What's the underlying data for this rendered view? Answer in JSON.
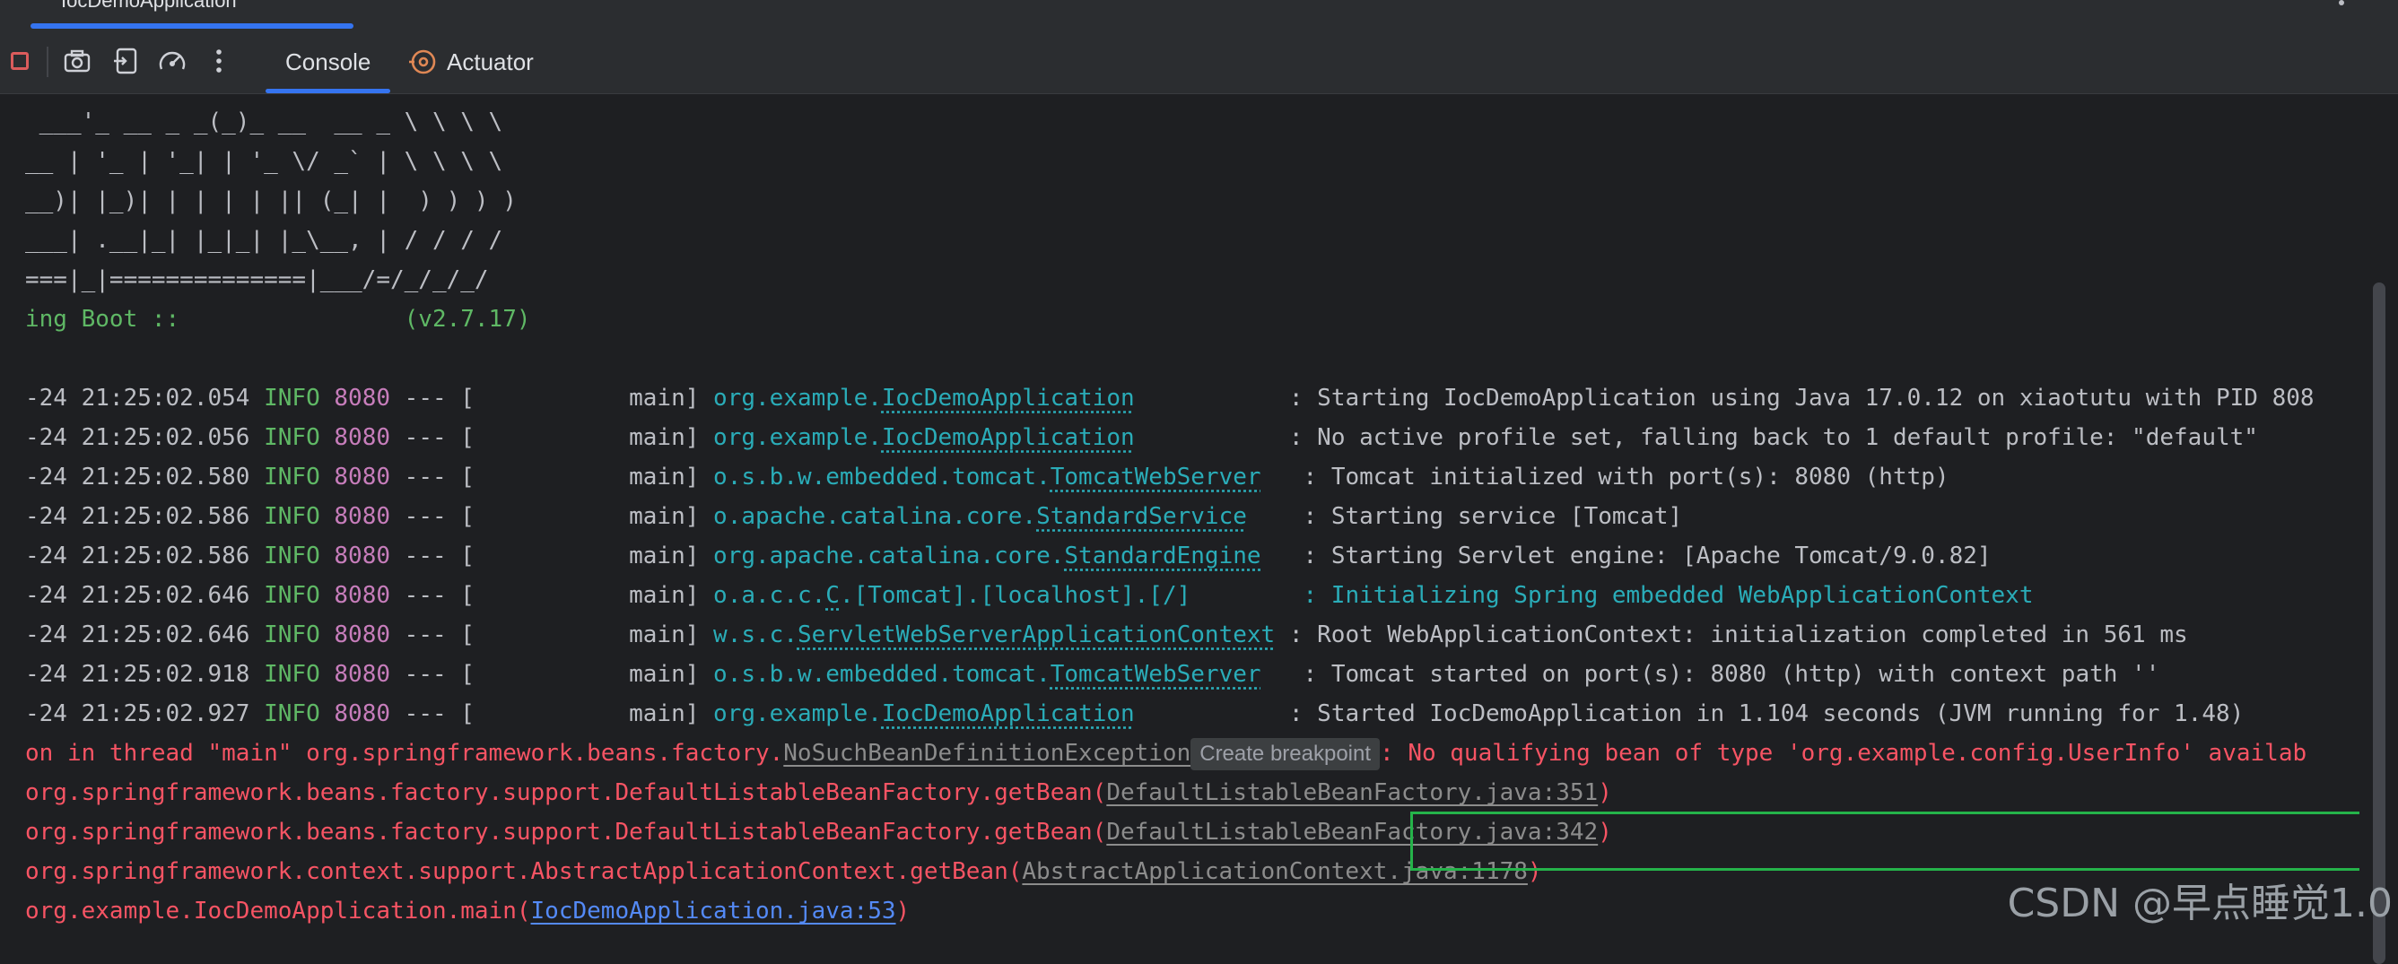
{
  "run_tab": {
    "label": "IocDemoApplication"
  },
  "toolbar": {
    "tabs": [
      {
        "label": "Console",
        "active": true
      },
      {
        "label": "Actuator",
        "active": false
      }
    ],
    "icons": [
      "stop-icon",
      "camera-icon",
      "restore-layout-icon",
      "speed-gauge-icon",
      "more-options-icon",
      "actuator-icon"
    ]
  },
  "banner": [
    " ___'_ __ _ _(_)_ __  __ _ \\ \\ \\ \\",
    "__ | '_ | '_| | '_ \\/ _` | \\ \\ \\ \\",
    "__)| |_)| | | | | || (_| |  ) ) ) )",
    "___| .__|_| |_|_| |_\\__, | / / / /",
    "===|_|==============|___/=/_/_/_/",
    "ing Boot ::                (v2.7.17)"
  ],
  "logs": [
    {
      "ts": "-24 21:25:02.054",
      "level": "INFO",
      "pid": "8080",
      "sep": " --- [           main] ",
      "pkg": "org.example.",
      "cls": "IocDemoApplication",
      "pad": "          ",
      "msg": " : Starting IocDemoApplication using Java 17.0.12 on xiaotutu with PID 808"
    },
    {
      "ts": "-24 21:25:02.056",
      "level": "INFO",
      "pid": "8080",
      "sep": " --- [           main] ",
      "pkg": "org.example.",
      "cls": "IocDemoApplication",
      "pad": "          ",
      "msg": " : No active profile set, falling back to 1 default profile: \"default\""
    },
    {
      "ts": "-24 21:25:02.580",
      "level": "INFO",
      "pid": "8080",
      "sep": " --- [           main] ",
      "pkg": "o.s.b.w.embedded.tomcat.",
      "cls": "TomcatWebServer",
      "pad": "  ",
      "msg": " : Tomcat initialized with port(s): 8080 (http)"
    },
    {
      "ts": "-24 21:25:02.586",
      "level": "INFO",
      "pid": "8080",
      "sep": " --- [           main] ",
      "pkg": "o.apache.catalina.core.",
      "cls": "StandardService",
      "pad": "   ",
      "msg": " : Starting service [Tomcat]"
    },
    {
      "ts": "-24 21:25:02.586",
      "level": "INFO",
      "pid": "8080",
      "sep": " --- [           main] ",
      "pkg": "org.apache.catalina.core.",
      "cls": "StandardEngine",
      "pad": "  ",
      "msg": " : Starting Servlet engine: [Apache Tomcat/9.0.82]"
    },
    {
      "ts": "-24 21:25:02.646",
      "level": "INFO",
      "pid": "8080",
      "sep": " --- [           main] ",
      "pkg": "o.a.c.c.",
      "cls": "C",
      "pad": "",
      "msg": ".[Tomcat].[localhost].[/]        : Initializing Spring embedded WebApplicationContext"
    },
    {
      "ts": "-24 21:25:02.646",
      "level": "INFO",
      "pid": "8080",
      "sep": " --- [           main] ",
      "pkg": "w.s.c.",
      "cls": "ServletWebServerApplicationContext",
      "pad": "",
      "msg": " : Root WebApplicationContext: initialization completed in 561 ms"
    },
    {
      "ts": "-24 21:25:02.918",
      "level": "INFO",
      "pid": "8080",
      "sep": " --- [           main] ",
      "pkg": "o.s.b.w.embedded.tomcat.",
      "cls": "TomcatWebServer",
      "pad": "  ",
      "msg": " : Tomcat started on port(s): 8080 (http) with context path ''"
    },
    {
      "ts": "-24 21:25:02.927",
      "level": "INFO",
      "pid": "8080",
      "sep": " --- [           main] ",
      "pkg": "org.example.",
      "cls": "IocDemoApplication",
      "pad": "          ",
      "msg": " : Started IocDemoApplication in 1.104 seconds (JVM running for 1.48)"
    }
  ],
  "exception": {
    "prefix": "on in thread \"main\" org.springframework.beans.factory.",
    "class_name": "NoSuchBeanDefinitionException",
    "tooltip": "Create breakpoint",
    "message": ": No qualifying bean of type 'org.example.config.UserInfo' availab"
  },
  "stack": [
    {
      "method": "org.springframework.beans.factory.support.DefaultListableBeanFactory.getBean(",
      "link": "DefaultListableBeanFactory.java:351",
      "close": ")",
      "blue": false
    },
    {
      "method": "org.springframework.beans.factory.support.DefaultListableBeanFactory.getBean(",
      "link": "DefaultListableBeanFactory.java:342",
      "close": ")",
      "blue": false
    },
    {
      "method": "org.springframework.context.support.AbstractApplicationContext.getBean(",
      "link": "AbstractApplicationContext.java:1178",
      "close": ")",
      "blue": false
    },
    {
      "method": "org.example.IocDemoApplication.main(",
      "link": "IocDemoApplication.java:53",
      "close": ")",
      "blue": true
    }
  ],
  "watermark": "CSDN @早点睡觉1.0",
  "colors": {
    "background": "#1e1f22",
    "info": "#5fb865",
    "pid": "#c77dbb",
    "logger": "#2aacb8",
    "error": "#f75464",
    "highlight_box": "#25b34a",
    "accent": "#3574f0"
  }
}
